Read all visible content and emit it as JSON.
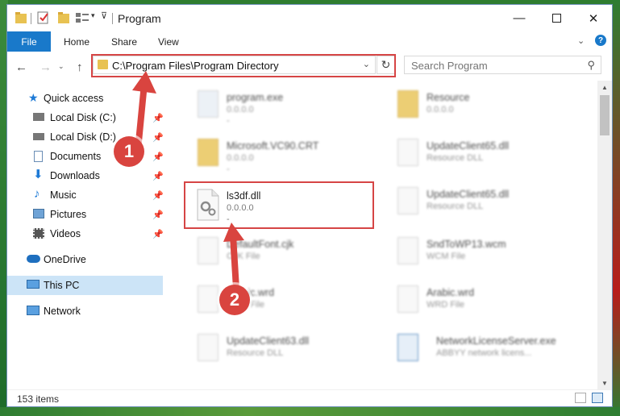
{
  "window": {
    "title": "Program"
  },
  "ribbon": {
    "tabs": [
      "File",
      "Home",
      "Share",
      "View"
    ]
  },
  "address": {
    "path": "C:\\Program Files\\Program Directory"
  },
  "search": {
    "placeholder": "Search Program"
  },
  "sidebar": {
    "items": [
      {
        "label": "Quick access",
        "icon": "star-icon"
      },
      {
        "label": "Local Disk (C:)",
        "icon": "drive-icon",
        "pinned": true
      },
      {
        "label": "Local Disk (D:)",
        "icon": "drive-icon",
        "pinned": true
      },
      {
        "label": "Documents",
        "icon": "documents-icon",
        "pinned": true
      },
      {
        "label": "Downloads",
        "icon": "download-icon",
        "pinned": true
      },
      {
        "label": "Music",
        "icon": "music-icon",
        "pinned": true
      },
      {
        "label": "Pictures",
        "icon": "pictures-icon",
        "pinned": true
      },
      {
        "label": "Videos",
        "icon": "videos-icon",
        "pinned": true
      },
      {
        "label": "OneDrive",
        "icon": "cloud-icon"
      },
      {
        "label": "This PC",
        "icon": "computer-icon",
        "selected": true
      },
      {
        "label": "Network",
        "icon": "network-icon"
      }
    ]
  },
  "files": [
    {
      "name": "program.exe",
      "line1": "0.0.0.0",
      "line2": "-"
    },
    {
      "name": "Resource",
      "line1": "0.0.0.0",
      "line2": ""
    },
    {
      "name": "Microsoft.VC90.CRT",
      "line1": "0.0.0.0",
      "line2": "-"
    },
    {
      "name": "UpdateClient65.dll",
      "line1": "Resource DLL",
      "line2": ""
    },
    {
      "name": "ls3df.dll",
      "line1": "0.0.0.0",
      "line2": "-"
    },
    {
      "name": "UpdateClient65.dll",
      "line1": "Resource DLL",
      "line2": ""
    },
    {
      "name": "DefaultFont.cjk",
      "line1": "CJK File",
      "line2": ""
    },
    {
      "name": "SndToWP13.wcm",
      "line1": "WCM File",
      "line2": ""
    },
    {
      "name": "Arabic.wrd",
      "line1": "WRD File",
      "line2": ""
    },
    {
      "name": "Arabic.wrd",
      "line1": "WRD File",
      "line2": ""
    },
    {
      "name": "UpdateClient63.dll",
      "line1": "Resource DLL",
      "line2": ""
    },
    {
      "name": "NetworkLicenseServer.exe",
      "line1": "ABBYY network licens...",
      "line2": ""
    }
  ],
  "status": {
    "items_count": "153 items"
  },
  "annotations": {
    "step1": "1",
    "step2": "2"
  },
  "colors": {
    "accent": "#1979ca",
    "highlight_box": "#d64545",
    "badge": "#d9443f",
    "selection": "#cce4f7"
  }
}
